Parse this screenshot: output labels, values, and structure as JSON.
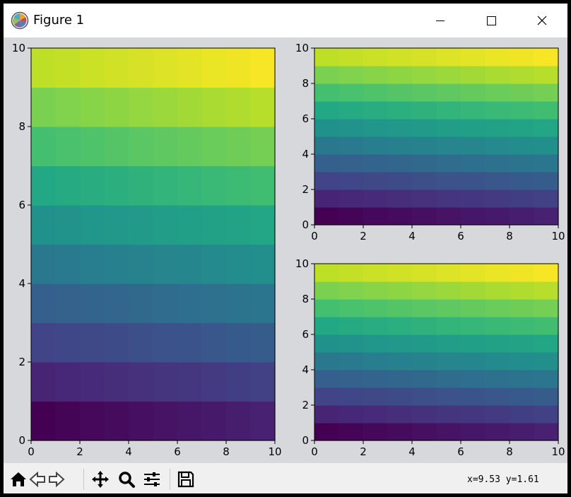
{
  "window": {
    "title": "Figure 1"
  },
  "toolbar": {
    "buttons": [
      "home",
      "back",
      "forward",
      "pan",
      "zoom",
      "configure-subplots",
      "save"
    ],
    "coords_text": "x=9.53 y=1.61"
  },
  "colormap": "viridis",
  "chart_data": [
    {
      "type": "heatmap",
      "grid": "10x10 cells",
      "value_rule": "row + column/10",
      "vmin": 0,
      "vmax": 10,
      "xlim": [
        0,
        10
      ],
      "ylim": [
        0,
        10
      ],
      "x_ticks": [
        "0",
        "2",
        "4",
        "6",
        "8",
        "10"
      ],
      "y_ticks": [
        "0",
        "2",
        "4",
        "6",
        "8",
        "10"
      ]
    },
    {
      "type": "heatmap",
      "grid": "10x10 cells",
      "value_rule": "row + column/10",
      "vmin": 0,
      "vmax": 10,
      "xlim": [
        0,
        10
      ],
      "ylim": [
        0,
        10
      ],
      "x_ticks": [
        "0",
        "2",
        "4",
        "6",
        "8",
        "10"
      ],
      "y_ticks": [
        "0",
        "2",
        "4",
        "6",
        "8",
        "10"
      ]
    },
    {
      "type": "heatmap",
      "grid": "10x10 cells",
      "value_rule": "row + column/10",
      "vmin": 0,
      "vmax": 10,
      "xlim": [
        0,
        10
      ],
      "ylim": [
        0,
        10
      ],
      "x_ticks": [
        "0",
        "2",
        "4",
        "6",
        "8",
        "10"
      ],
      "y_ticks": [
        "0",
        "2",
        "4",
        "6",
        "8",
        "10"
      ]
    }
  ]
}
